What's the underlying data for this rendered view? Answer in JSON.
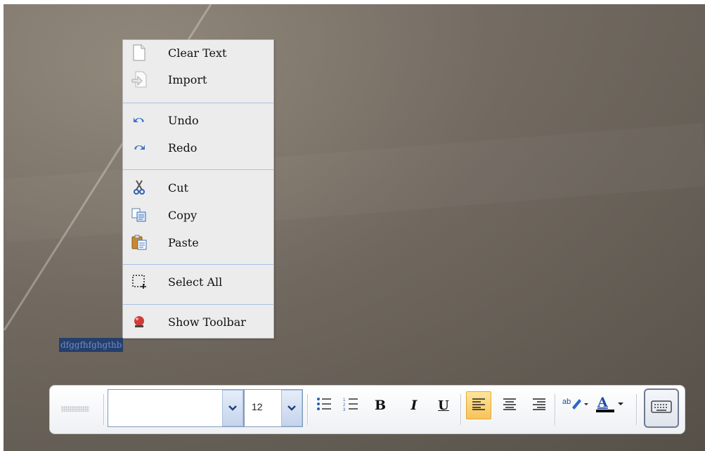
{
  "context_menu": {
    "items": [
      {
        "label": "Clear Text",
        "icon": "blank-page-icon"
      },
      {
        "label": "Import",
        "icon": "import-icon"
      },
      {
        "label": "Undo",
        "icon": "undo-icon"
      },
      {
        "label": "Redo",
        "icon": "redo-icon"
      },
      {
        "label": "Cut",
        "icon": "scissors-icon"
      },
      {
        "label": "Copy",
        "icon": "copy-icon"
      },
      {
        "label": "Paste",
        "icon": "paste-icon"
      },
      {
        "label": "Select All",
        "icon": "select-all-icon"
      },
      {
        "label": "Show Toolbar",
        "icon": "show-toolbar-icon"
      }
    ]
  },
  "editor": {
    "selected_text": "dfggfhfghgthb"
  },
  "toolbar": {
    "font_name": "",
    "font_size": "12",
    "buttons": [
      "bullet-list",
      "numbered-list",
      "bold",
      "italic",
      "underline",
      "align-left",
      "align-center",
      "align-right",
      "highlight-color",
      "font-color",
      "keyboard"
    ],
    "bold_label": "B",
    "italic_label": "I",
    "underline_label": "U",
    "active_alignment": "align-left"
  },
  "colors": {
    "menu_bg": "#ececec",
    "separator": "#a9c3e6",
    "selection_bg": "#253e6b",
    "active_button": "#f7c35a",
    "font_color_bar": "#000000"
  }
}
